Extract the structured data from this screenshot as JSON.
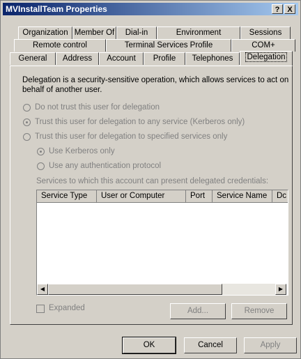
{
  "window": {
    "title": "MVInstallTeam Properties",
    "help_btn": "?",
    "close_btn": "X"
  },
  "tabs": {
    "row1": [
      "Organization",
      "Member Of",
      "Dial-in",
      "Environment",
      "Sessions"
    ],
    "row2": [
      "Remote control",
      "Terminal Services Profile",
      "COM+"
    ],
    "row3": [
      "General",
      "Address",
      "Account",
      "Profile",
      "Telephones",
      "Delegation"
    ]
  },
  "delegation": {
    "description": "Delegation is a security-sensitive operation, which allows services to act on behalf of another user.",
    "options": [
      "Do not trust this user for delegation",
      "Trust this user for delegation to any service (Kerberos only)",
      "Trust this user for delegation to specified services only"
    ],
    "sub_options": [
      "Use Kerberos only",
      "Use any authentication protocol"
    ],
    "services_label": "Services to which this account can present delegated credentials:",
    "columns": [
      "Service Type",
      "User or Computer",
      "Port",
      "Service Name",
      "Dc"
    ],
    "expanded_label": "Expanded",
    "add_button": "Add...",
    "remove_button": "Remove"
  },
  "buttons": {
    "ok": "OK",
    "cancel": "Cancel",
    "apply": "Apply"
  }
}
